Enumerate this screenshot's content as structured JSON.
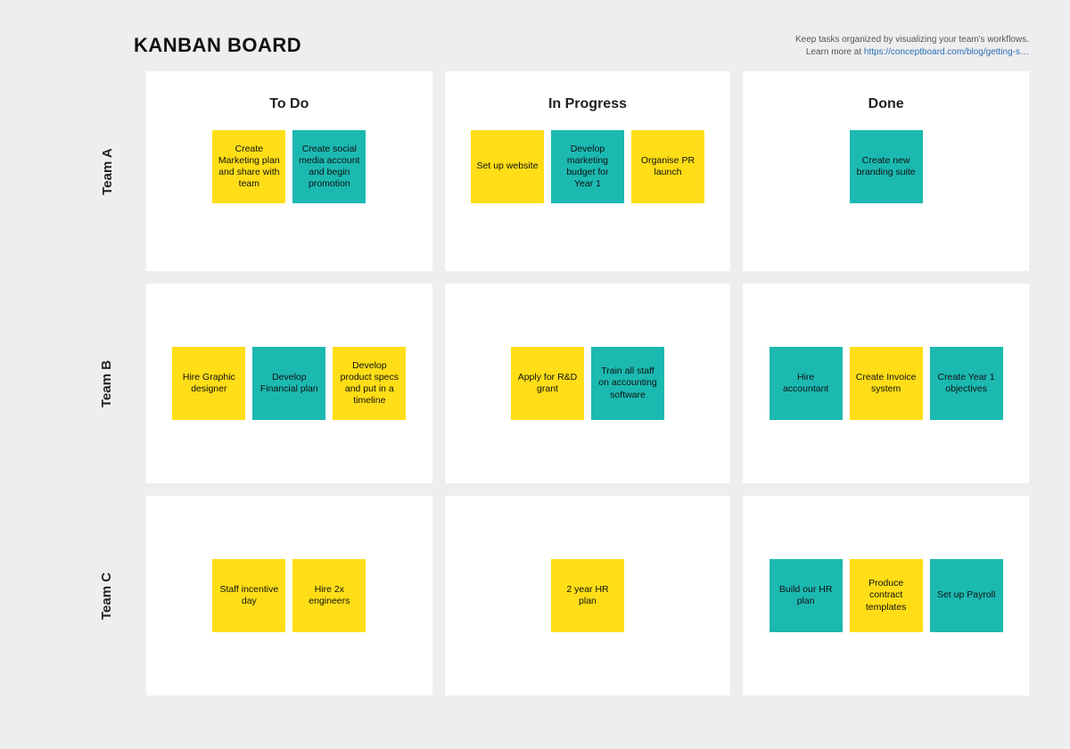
{
  "title": "KANBAN BOARD",
  "hint_line1": "Keep tasks organized by visualizing your team's workflows.",
  "hint_line2_prefix": "Learn more at ",
  "hint_link_text": "https://conceptboard.com/blog/getting-s…",
  "columns": [
    "To Do",
    "In Progress",
    "Done"
  ],
  "rows": [
    "Team A",
    "Team B",
    "Team C"
  ],
  "colors": {
    "yellow": "#ffde17",
    "teal": "#1cb9b1"
  },
  "cells": {
    "a_todo": [
      {
        "text": "Create Marketing plan and share with team",
        "color": "yellow"
      },
      {
        "text": "Create social media account and begin promotion",
        "color": "teal"
      }
    ],
    "a_prog": [
      {
        "text": "Set up website",
        "color": "yellow"
      },
      {
        "text": "Develop marketing budget for Year 1",
        "color": "teal"
      },
      {
        "text": "Organise PR launch",
        "color": "yellow"
      }
    ],
    "a_done": [
      {
        "text": "Create new branding suite",
        "color": "teal"
      }
    ],
    "b_todo": [
      {
        "text": "Hire Graphic designer",
        "color": "yellow"
      },
      {
        "text": "Develop Financial plan",
        "color": "teal"
      },
      {
        "text": "Develop product specs and put in a timeline",
        "color": "yellow"
      }
    ],
    "b_prog": [
      {
        "text": "Apply for R&D grant",
        "color": "yellow"
      },
      {
        "text": "Train all staff on accounting software",
        "color": "teal"
      }
    ],
    "b_done": [
      {
        "text": "Hire accountant",
        "color": "teal"
      },
      {
        "text": "Create Invoice system",
        "color": "yellow"
      },
      {
        "text": "Create Year 1 objectives",
        "color": "teal"
      }
    ],
    "c_todo": [
      {
        "text": "Staff incentive day",
        "color": "yellow"
      },
      {
        "text": "Hire 2x engineers",
        "color": "yellow"
      }
    ],
    "c_prog": [
      {
        "text": "2 year HR plan",
        "color": "yellow"
      }
    ],
    "c_done": [
      {
        "text": "Build our HR plan",
        "color": "teal"
      },
      {
        "text": "Produce contract templates",
        "color": "yellow"
      },
      {
        "text": "Set up Payroll",
        "color": "teal"
      }
    ]
  }
}
